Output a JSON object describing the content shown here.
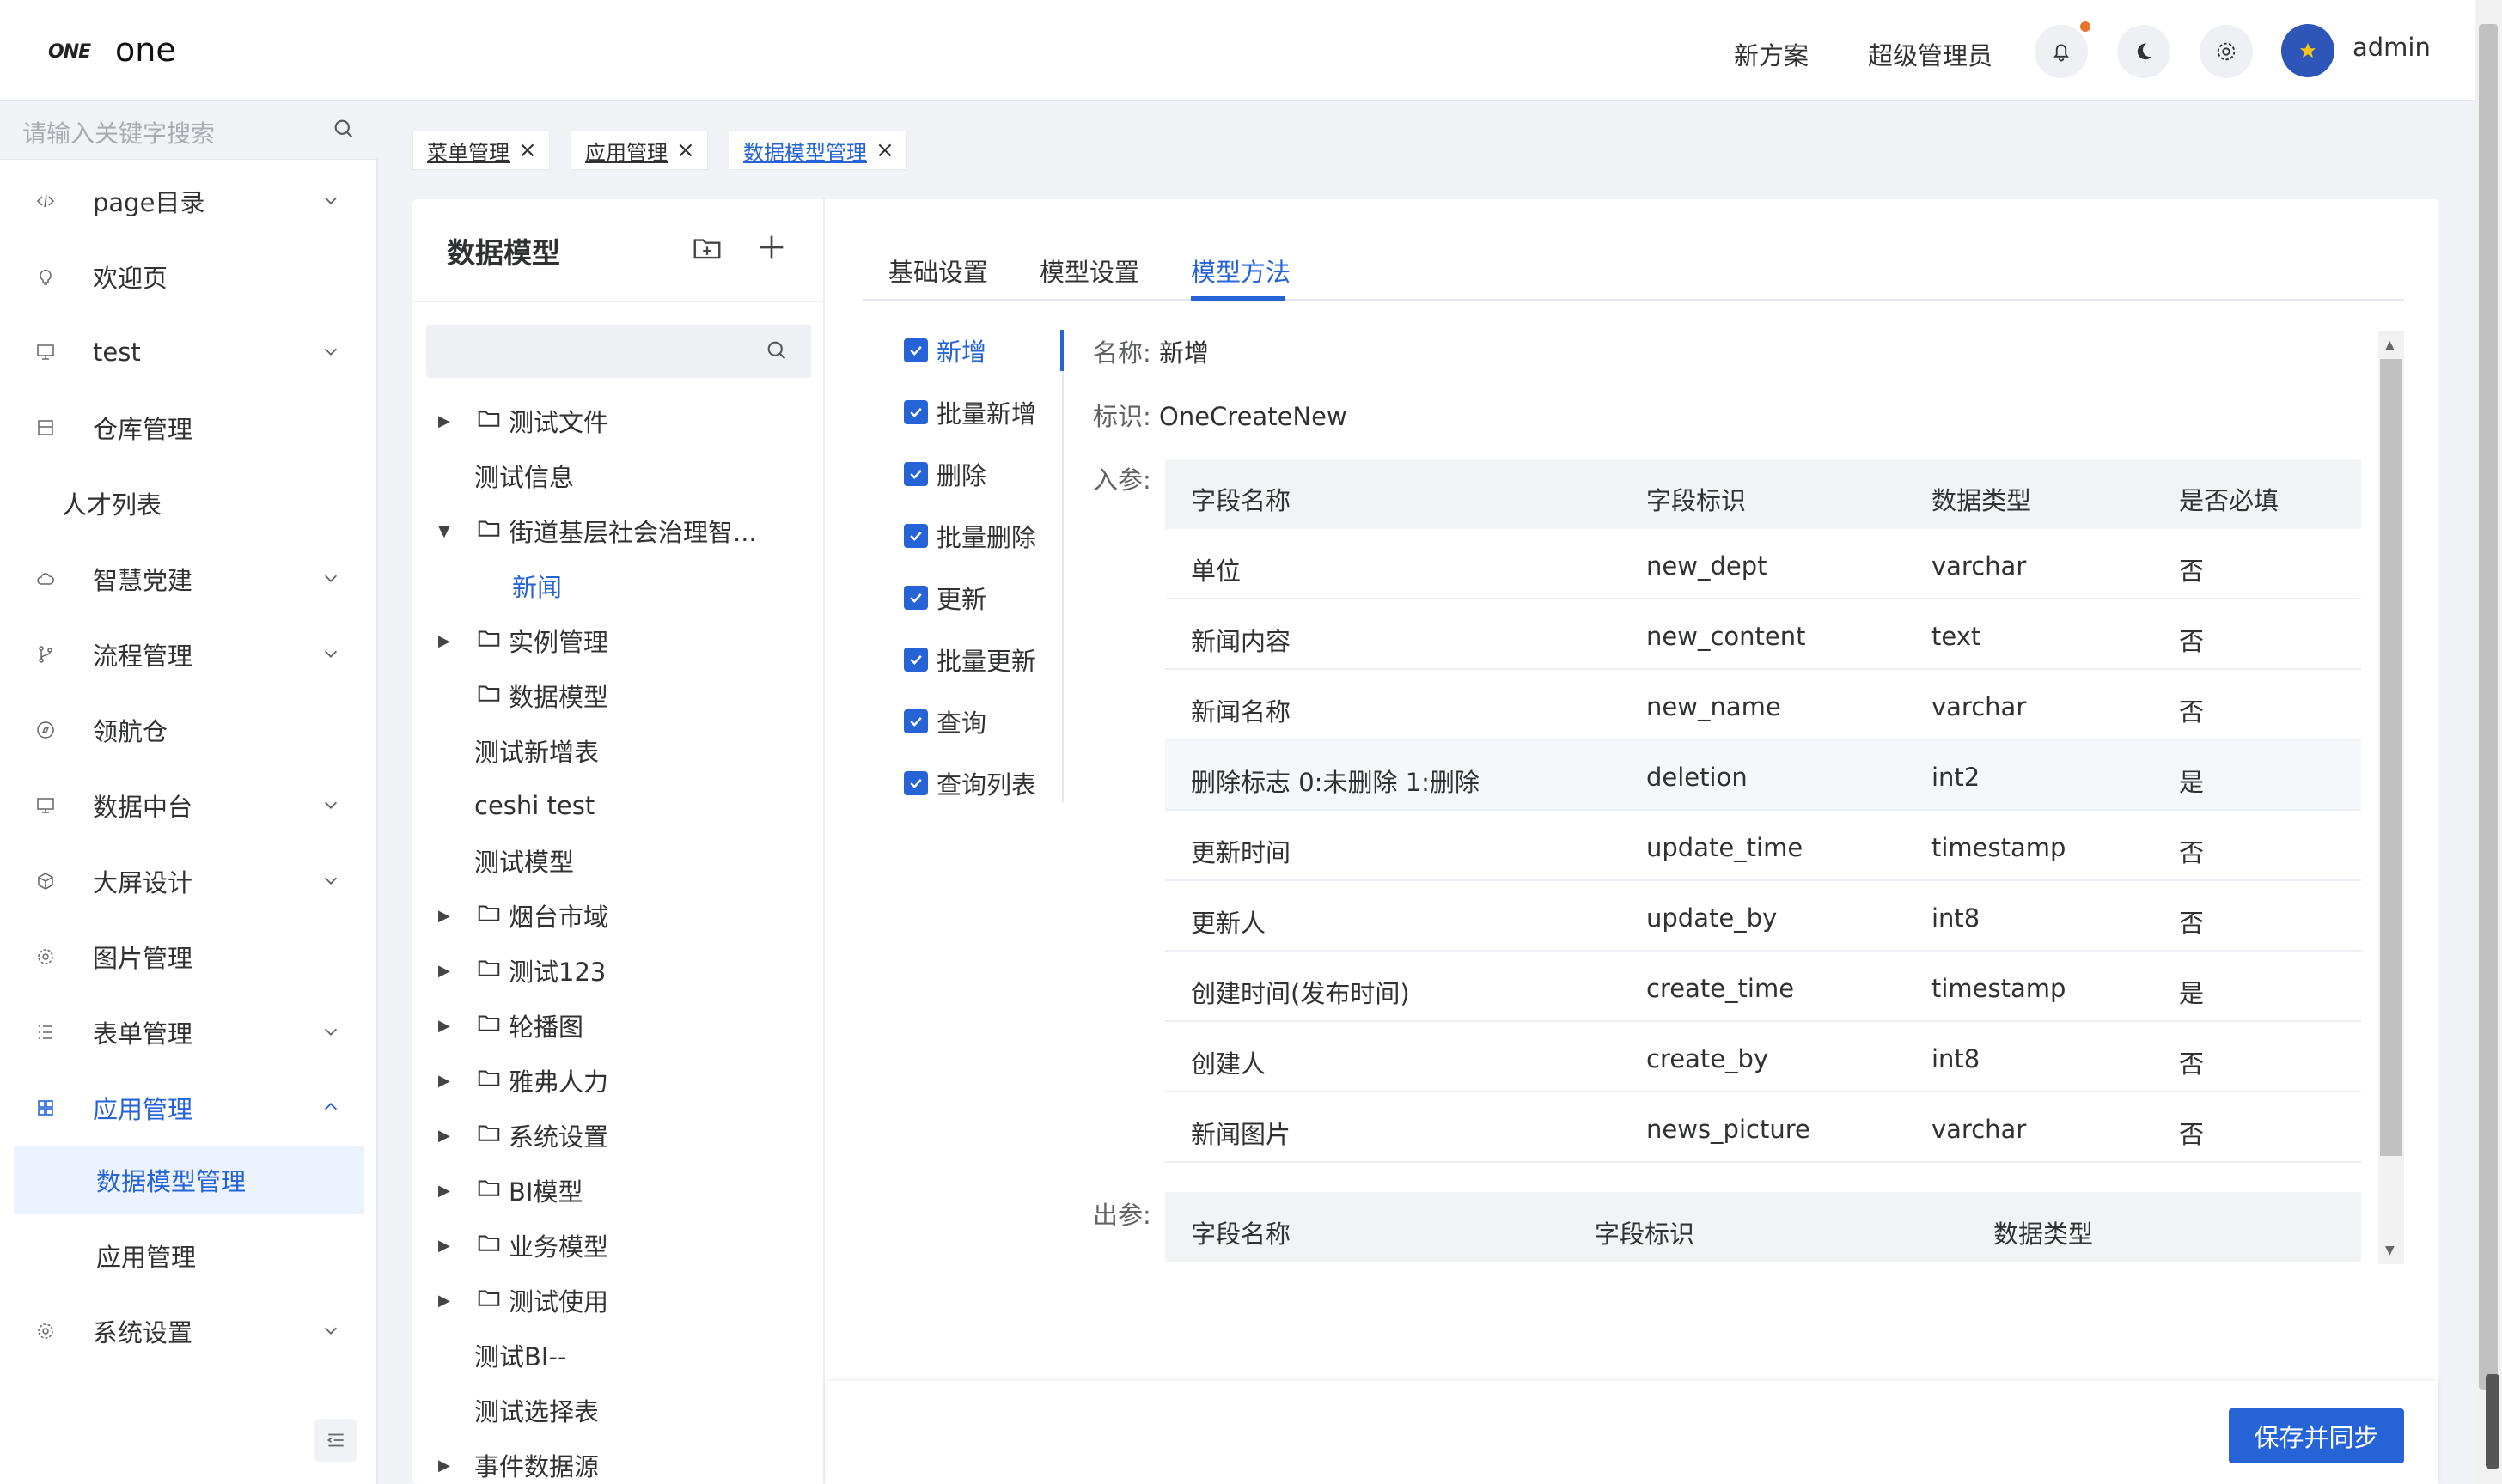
{
  "header": {
    "logo_text": "ONE",
    "app_title": "one",
    "links": [
      "新方案",
      "超级管理员"
    ],
    "username": "admin"
  },
  "sidebar": {
    "search_placeholder": "请输入关键字搜索",
    "items": [
      {
        "label": "page目录",
        "icon": "code-icon",
        "expandable": true
      },
      {
        "label": "欢迎页",
        "icon": "bulb-icon",
        "expandable": false
      },
      {
        "label": "test",
        "icon": "monitor-icon",
        "expandable": true
      },
      {
        "label": "仓库管理",
        "icon": "box-icon",
        "expandable": false
      },
      {
        "label": "人才列表",
        "icon": "",
        "expandable": false
      },
      {
        "label": "智慧党建",
        "icon": "cloud-icon",
        "expandable": true
      },
      {
        "label": "流程管理",
        "icon": "branch-icon",
        "expandable": true
      },
      {
        "label": "领航仓",
        "icon": "compass-icon",
        "expandable": false
      },
      {
        "label": "数据中台",
        "icon": "monitor-icon",
        "expandable": true
      },
      {
        "label": "大屏设计",
        "icon": "cube-icon",
        "expandable": true
      },
      {
        "label": "图片管理",
        "icon": "gear-icon",
        "expandable": false
      },
      {
        "label": "表单管理",
        "icon": "list-icon",
        "expandable": true
      },
      {
        "label": "应用管理",
        "icon": "grid-icon",
        "expandable": true
      }
    ],
    "sub_items": [
      "数据模型管理",
      "应用管理"
    ],
    "last_item": {
      "label": "系统设置",
      "icon": "gear-icon"
    }
  },
  "tabs": [
    {
      "label": "菜单管理"
    },
    {
      "label": "应用管理"
    },
    {
      "label": "数据模型管理"
    }
  ],
  "tree": {
    "title": "数据模型",
    "nodes": [
      {
        "label": "测试文件",
        "folder": true,
        "arrow": "▶"
      },
      {
        "label": "测试信息",
        "folder": false,
        "arrow": ""
      },
      {
        "label": "街道基层社会治理智...",
        "folder": true,
        "arrow": "▼"
      },
      {
        "label": "新闻",
        "folder": false,
        "arrow": "",
        "child": true
      },
      {
        "label": "实例管理",
        "folder": true,
        "arrow": "▶"
      },
      {
        "label": "数据模型",
        "folder": true,
        "arrow": ""
      },
      {
        "label": "测试新增表",
        "folder": false,
        "arrow": ""
      },
      {
        "label": "ceshi test",
        "folder": false,
        "arrow": ""
      },
      {
        "label": "测试模型",
        "folder": false,
        "arrow": ""
      },
      {
        "label": "烟台市域",
        "folder": true,
        "arrow": "▶"
      },
      {
        "label": "测试123",
        "folder": true,
        "arrow": "▶"
      },
      {
        "label": "轮播图",
        "folder": true,
        "arrow": "▶"
      },
      {
        "label": "雅弗人力",
        "folder": true,
        "arrow": "▶"
      },
      {
        "label": "系统设置",
        "folder": true,
        "arrow": "▶"
      },
      {
        "label": "BI模型",
        "folder": true,
        "arrow": "▶"
      },
      {
        "label": "业务模型",
        "folder": true,
        "arrow": "▶"
      },
      {
        "label": "测试使用",
        "folder": true,
        "arrow": "▶"
      },
      {
        "label": "测试BI--",
        "folder": false,
        "arrow": ""
      },
      {
        "label": "测试选择表",
        "folder": false,
        "arrow": ""
      },
      {
        "label": "事件数据源",
        "folder": false,
        "arrow": "▶"
      }
    ]
  },
  "content_tabs": [
    "基础设置",
    "模型设置",
    "模型方法"
  ],
  "methods": [
    "新增",
    "批量新增",
    "删除",
    "批量删除",
    "更新",
    "批量更新",
    "查询",
    "查询列表"
  ],
  "detail": {
    "name_label": "名称:",
    "name_value": "新增",
    "id_label": "标识:",
    "id_value": "OneCreateNew",
    "in_label": "入参:",
    "out_label": "出参:",
    "in_headers": [
      "字段名称",
      "字段标识",
      "数据类型",
      "是否必填"
    ],
    "in_rows": [
      [
        "单位",
        "new_dept",
        "varchar",
        "否"
      ],
      [
        "新闻内容",
        "new_content",
        "text",
        "否"
      ],
      [
        "新闻名称",
        "new_name",
        "varchar",
        "否"
      ],
      [
        "删除标志 0:未删除 1:删除",
        "deletion",
        "int2",
        "是"
      ],
      [
        "更新时间",
        "update_time",
        "timestamp",
        "否"
      ],
      [
        "更新人",
        "update_by",
        "int8",
        "否"
      ],
      [
        "创建时间(发布时间)",
        "create_time",
        "timestamp",
        "是"
      ],
      [
        "创建人",
        "create_by",
        "int8",
        "否"
      ],
      [
        "新闻图片",
        "news_picture",
        "varchar",
        "否"
      ]
    ],
    "out_headers": [
      "字段名称",
      "字段标识",
      "数据类型"
    ]
  },
  "save_button": "保存并同步",
  "colors": {
    "accent": "#2563d6",
    "notification_dot": "#e6742c"
  }
}
